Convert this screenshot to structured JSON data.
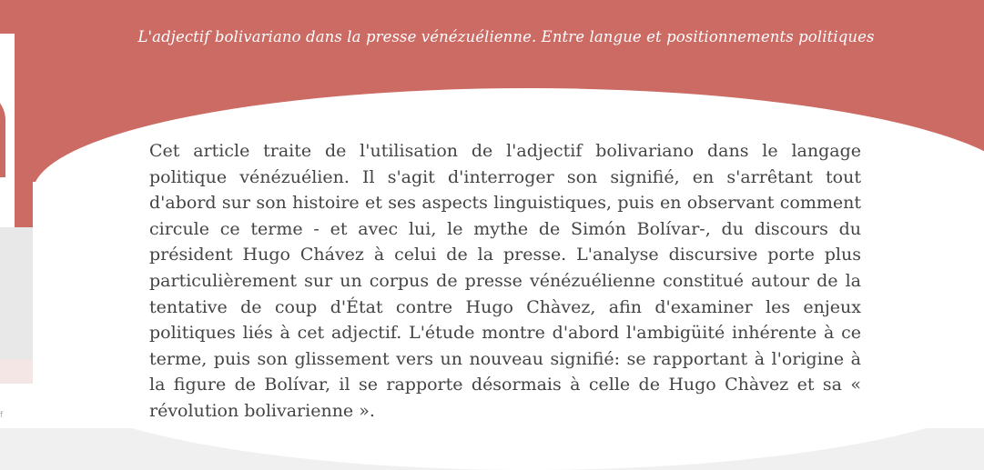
{
  "article": {
    "title": "L'adjectif bolivariano dans la presse vénézuélienne. Entre langue et positionnements politiques",
    "abstract": "Cet article traite de l'utilisation de l'adjectif bolivariano dans le langage politique vénézuélien. Il s'agit d'interroger son signifié, en s'arrêtant tout d'abord sur son histoire et ses aspects linguistiques, puis en observant comment circule ce terme - et avec lui, le mythe de Simón Bolívar-, du discours du président Hugo Chávez à celui de la presse. L'analyse discursive porte plus particulièrement sur un corpus de presse vénézuélienne constitué autour de la tentative de coup d'État contre Hugo Chàvez, afin d'examiner les enjeux politiques liés à cet adjectif. L'étude montre d'abord l'ambigüité inhérente à ce terme, puis son glissement vers un nouveau signifié: se rapportant à l'origine à la figure de Bolívar, il se rapporte désormais à celle de Hugo Chàvez et sa « révolution bolivarienne »."
  },
  "sidebar": {
    "edge_glyph": "f"
  },
  "colors": {
    "header_bg": "#cc6a64",
    "card_bg": "#ffffff",
    "text": "#444444",
    "title_text": "#ffffff"
  }
}
